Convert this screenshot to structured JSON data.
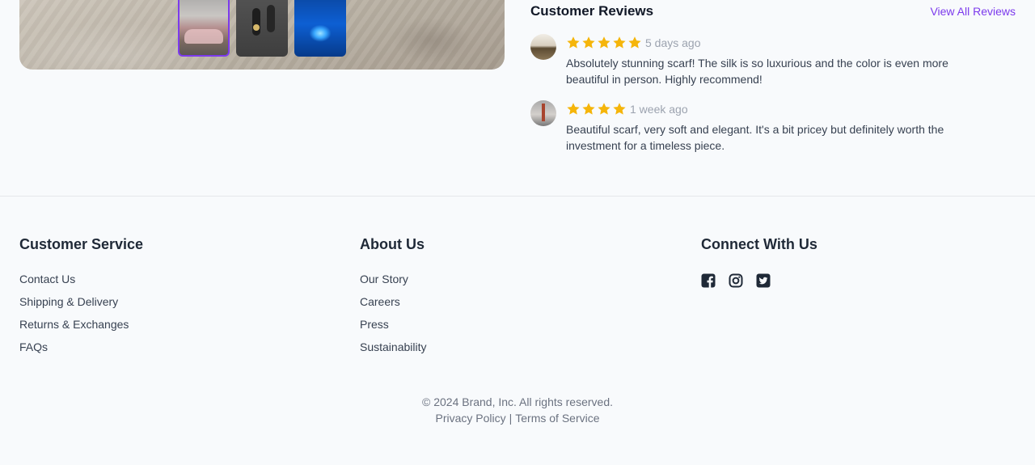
{
  "reviews": {
    "title": "Customer Reviews",
    "view_all": "View All Reviews",
    "items": [
      {
        "rating": 5,
        "ago": "5 days ago",
        "text": "Absolutely stunning scarf! The silk is so luxurious and the color is even more beautiful in person. Highly recommend!"
      },
      {
        "rating": 4,
        "ago": "1 week ago",
        "text": "Beautiful scarf, very soft and elegant. It's a bit pricey but definitely worth the investment for a timeless piece."
      }
    ]
  },
  "colors": {
    "accent": "#7c3aed",
    "star": "#f5b50a"
  },
  "footer": {
    "customer_service": {
      "title": "Customer Service",
      "links": [
        "Contact Us",
        "Shipping & Delivery",
        "Returns & Exchanges",
        "FAQs"
      ]
    },
    "about": {
      "title": "About Us",
      "links": [
        "Our Story",
        "Careers",
        "Press",
        "Sustainability"
      ]
    },
    "connect": {
      "title": "Connect With Us",
      "icons": [
        "facebook-icon",
        "instagram-icon",
        "twitter-icon"
      ]
    },
    "copyright": "© 2024 Brand, Inc. All rights reserved.",
    "privacy": "Privacy Policy",
    "separator": "|",
    "terms": "Terms of Service"
  }
}
